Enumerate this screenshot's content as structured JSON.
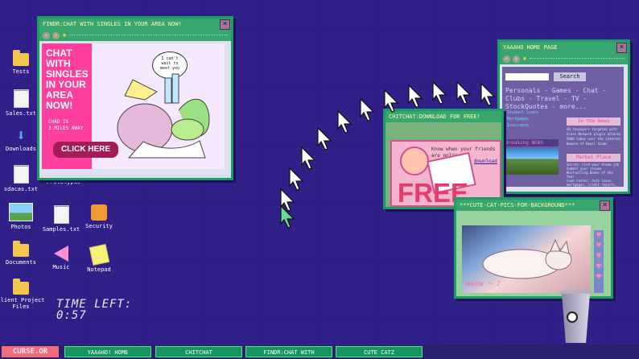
{
  "desktop_icons": {
    "tests": "Tests",
    "sales": "Sales.txt",
    "downloads": "Downloads",
    "sdacas": "sdacas.txt",
    "photos": "Photos",
    "documents": "Documents",
    "client_project_files": "Client Project Files",
    "prototypes": "Prototypes",
    "samples": "Samples.txt",
    "music": "Music",
    "security": "Security",
    "notepad": "Notepad"
  },
  "timer": {
    "label": "TIME LEFT:",
    "value": "0:57"
  },
  "windows": {
    "findr": {
      "title": "FINDR:CHAT WITH SINGLES IN YOUR AREA NOW!",
      "headline": "CHAT WITH SINGLES IN YOUR AREA NOW!",
      "speech": "I can't wait to meet you",
      "distance_name": "CHAD IS",
      "distance_value": "3 MILES AWAY",
      "cta": "CLICK HERE"
    },
    "yaaaho": {
      "title": "YAAAHO HOME PAGE",
      "search_button": "Search",
      "links": "Personals - Games - Chat - Clubs - Travel - TV - StockQuotes - more...",
      "news_header": "In the News",
      "news_items": [
        "40 taxpayers targeted with Green Network plugin attacks",
        "5000 tubes over the internet",
        "Beware of Email Scams"
      ],
      "menu_items": [
        "Student Loans",
        "Mortgages",
        "Insurance"
      ],
      "breaking_news": "Breaking NEWS",
      "market_header": "Market Place",
      "market_items": [
        "Secret: Find your dream job",
        "Submit your resume",
        "Bestselling Books of the Year",
        "Loan Center: Auto loans, mortgages, credit reports, etc."
      ]
    },
    "chitchat": {
      "title": "CHITCHAT:DOWNLOAD FOR FREE!",
      "headline": "Know when your friends are online",
      "download_link": "download",
      "banner": "FREE"
    },
    "catz": {
      "title": "***CUTE-CAT-PICS-FOR-BACKGROUND***",
      "caption": "meow ~ ♪"
    }
  },
  "taskbar": {
    "brand": "CURSE.OR",
    "tasks": [
      "YAAAHO! HOME",
      "CHITCHAT",
      "FINDR:CHAT WITH",
      "CUTE CATZ"
    ]
  },
  "colors": {
    "desktop": "#2f1f86",
    "window_green": "#38a66e",
    "accent_pink": "#ff4fa0",
    "cursor_green": "#6ad79b"
  }
}
